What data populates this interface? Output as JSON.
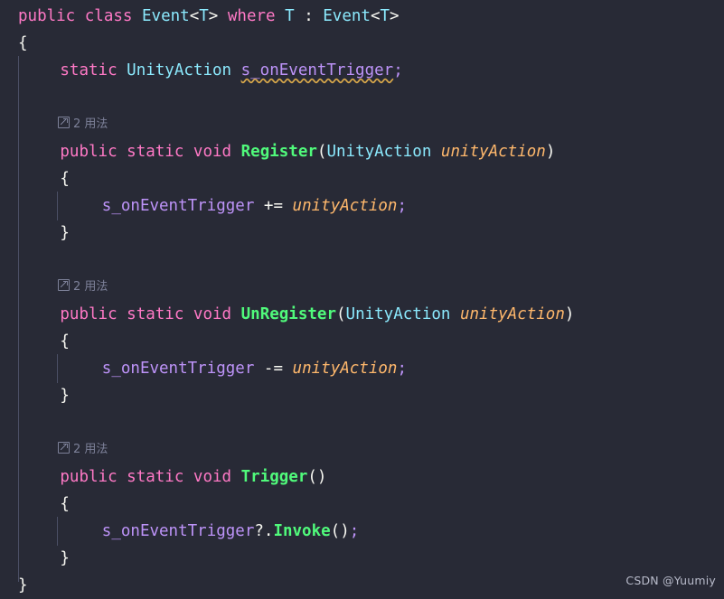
{
  "editor": {
    "background": "#282a36",
    "font_size_px": 17.5,
    "line_height_px": 30,
    "indent_guide_color": "#4b4f66",
    "warning_squiggle_color": "#d7a74a"
  },
  "palette": {
    "keyword": "#ff79c6",
    "type": "#8be9fd",
    "function": "#50fa7b",
    "field": "#bd93f8",
    "parameter": "#ffb86c",
    "punctuation": "#f8f8f2",
    "codelens": "#7d8199",
    "watermark": "#b9bccb"
  },
  "codelens": {
    "icon": "reference-arrow-icon",
    "count": "2",
    "label": "用法",
    "full": "2 用法"
  },
  "watermark": {
    "text": "CSDN @Yuumiy"
  },
  "code": {
    "lines": [
      {
        "n": 1,
        "indent": 0,
        "tokens": [
          {
            "t": "public",
            "c": "kw"
          },
          {
            "t": " ",
            "c": "punc"
          },
          {
            "t": "class",
            "c": "kw"
          },
          {
            "t": " ",
            "c": "punc"
          },
          {
            "t": "Event",
            "c": "type"
          },
          {
            "t": "<",
            "c": "punc"
          },
          {
            "t": "T",
            "c": "type"
          },
          {
            "t": ">",
            "c": "punc"
          },
          {
            "t": " ",
            "c": "punc"
          },
          {
            "t": "where",
            "c": "kw"
          },
          {
            "t": " ",
            "c": "punc"
          },
          {
            "t": "T",
            "c": "type"
          },
          {
            "t": " : ",
            "c": "punc"
          },
          {
            "t": "Event",
            "c": "type"
          },
          {
            "t": "<",
            "c": "punc"
          },
          {
            "t": "T",
            "c": "type"
          },
          {
            "t": ">",
            "c": "punc"
          }
        ],
        "text": "public class Event<T> where T : Event<T>"
      },
      {
        "n": 2,
        "indent": 0,
        "tokens": [
          {
            "t": "{",
            "c": "punc"
          }
        ],
        "text": "{"
      },
      {
        "n": 3,
        "indent": 4,
        "tokens": [
          {
            "t": "static",
            "c": "kw"
          },
          {
            "t": " ",
            "c": "punc"
          },
          {
            "t": "UnityAction",
            "c": "type"
          },
          {
            "t": " ",
            "c": "punc"
          },
          {
            "t": "s_onEventTrigger",
            "c": "field warn"
          },
          {
            "t": ";",
            "c": "semi"
          }
        ],
        "text": "    static UnityAction s_onEventTrigger;"
      },
      {
        "n": 4,
        "indent": 0,
        "tokens": [],
        "text": ""
      },
      {
        "n": 5,
        "codelens": true,
        "indent": 4,
        "text": "2 用法"
      },
      {
        "n": 6,
        "indent": 4,
        "tokens": [
          {
            "t": "public",
            "c": "kw"
          },
          {
            "t": " ",
            "c": "punc"
          },
          {
            "t": "static",
            "c": "kw"
          },
          {
            "t": " ",
            "c": "punc"
          },
          {
            "t": "void",
            "c": "kw"
          },
          {
            "t": " ",
            "c": "punc"
          },
          {
            "t": "Register",
            "c": "fn"
          },
          {
            "t": "(",
            "c": "punc"
          },
          {
            "t": "UnityAction",
            "c": "type"
          },
          {
            "t": " ",
            "c": "punc"
          },
          {
            "t": "unityAction",
            "c": "param"
          },
          {
            "t": ")",
            "c": "punc"
          }
        ],
        "text": "    public static void Register(UnityAction unityAction)"
      },
      {
        "n": 7,
        "indent": 4,
        "tokens": [
          {
            "t": "{",
            "c": "punc"
          }
        ],
        "text": "    {"
      },
      {
        "n": 8,
        "indent": 8,
        "tokens": [
          {
            "t": "s_onEventTrigger",
            "c": "field"
          },
          {
            "t": " ",
            "c": "punc"
          },
          {
            "t": "+=",
            "c": "punc"
          },
          {
            "t": " ",
            "c": "punc"
          },
          {
            "t": "unityAction",
            "c": "param"
          },
          {
            "t": ";",
            "c": "semi"
          }
        ],
        "text": "        s_onEventTrigger += unityAction;"
      },
      {
        "n": 9,
        "indent": 4,
        "tokens": [
          {
            "t": "}",
            "c": "punc"
          }
        ],
        "text": "    }"
      },
      {
        "n": 10,
        "indent": 0,
        "tokens": [],
        "text": ""
      },
      {
        "n": 11,
        "codelens": true,
        "indent": 4,
        "text": "2 用法"
      },
      {
        "n": 12,
        "indent": 4,
        "tokens": [
          {
            "t": "public",
            "c": "kw"
          },
          {
            "t": " ",
            "c": "punc"
          },
          {
            "t": "static",
            "c": "kw"
          },
          {
            "t": " ",
            "c": "punc"
          },
          {
            "t": "void",
            "c": "kw"
          },
          {
            "t": " ",
            "c": "punc"
          },
          {
            "t": "UnRegister",
            "c": "fn"
          },
          {
            "t": "(",
            "c": "punc"
          },
          {
            "t": "UnityAction",
            "c": "type"
          },
          {
            "t": " ",
            "c": "punc"
          },
          {
            "t": "unityAction",
            "c": "param"
          },
          {
            "t": ")",
            "c": "punc"
          }
        ],
        "text": "    public static void UnRegister(UnityAction unityAction)"
      },
      {
        "n": 13,
        "indent": 4,
        "tokens": [
          {
            "t": "{",
            "c": "punc"
          }
        ],
        "text": "    {"
      },
      {
        "n": 14,
        "indent": 8,
        "tokens": [
          {
            "t": "s_onEventTrigger",
            "c": "field"
          },
          {
            "t": " ",
            "c": "punc"
          },
          {
            "t": "-=",
            "c": "punc"
          },
          {
            "t": " ",
            "c": "punc"
          },
          {
            "t": "unityAction",
            "c": "param"
          },
          {
            "t": ";",
            "c": "semi"
          }
        ],
        "text": "        s_onEventTrigger -= unityAction;"
      },
      {
        "n": 15,
        "indent": 4,
        "tokens": [
          {
            "t": "}",
            "c": "punc"
          }
        ],
        "text": "    }"
      },
      {
        "n": 16,
        "indent": 0,
        "tokens": [],
        "text": ""
      },
      {
        "n": 17,
        "codelens": true,
        "indent": 4,
        "text": "2 用法"
      },
      {
        "n": 18,
        "indent": 4,
        "tokens": [
          {
            "t": "public",
            "c": "kw"
          },
          {
            "t": " ",
            "c": "punc"
          },
          {
            "t": "static",
            "c": "kw"
          },
          {
            "t": " ",
            "c": "punc"
          },
          {
            "t": "void",
            "c": "kw"
          },
          {
            "t": " ",
            "c": "punc"
          },
          {
            "t": "Trigger",
            "c": "fn"
          },
          {
            "t": "()",
            "c": "punc"
          }
        ],
        "text": "    public static void Trigger()"
      },
      {
        "n": 19,
        "indent": 4,
        "tokens": [
          {
            "t": "{",
            "c": "punc"
          }
        ],
        "text": "    {"
      },
      {
        "n": 20,
        "indent": 8,
        "tokens": [
          {
            "t": "s_onEventTrigger",
            "c": "field"
          },
          {
            "t": "?.",
            "c": "punc"
          },
          {
            "t": "Invoke",
            "c": "fn"
          },
          {
            "t": "()",
            "c": "punc"
          },
          {
            "t": ";",
            "c": "semi"
          }
        ],
        "text": "        s_onEventTrigger?.Invoke();"
      },
      {
        "n": 21,
        "indent": 4,
        "tokens": [
          {
            "t": "}",
            "c": "punc"
          }
        ],
        "text": "    }"
      },
      {
        "n": 22,
        "indent": 0,
        "tokens": [
          {
            "t": "}",
            "c": "punc"
          }
        ],
        "text": "}"
      }
    ]
  }
}
